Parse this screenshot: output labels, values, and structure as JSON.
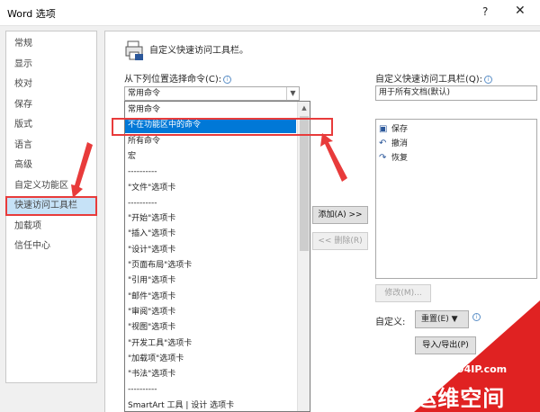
{
  "window": {
    "title": "Word 选项",
    "help": "?",
    "close": "✕"
  },
  "sidebar": {
    "items": [
      {
        "label": "常规"
      },
      {
        "label": "显示"
      },
      {
        "label": "校对"
      },
      {
        "label": "保存"
      },
      {
        "label": "版式"
      },
      {
        "label": "语言"
      },
      {
        "label": "高级"
      },
      {
        "label": "自定义功能区"
      },
      {
        "label": "快速访问工具栏",
        "selected": true
      },
      {
        "label": "加载项"
      },
      {
        "label": "信任中心"
      }
    ]
  },
  "main": {
    "title": "自定义快速访问工具栏。",
    "choose_from_label": "从下列位置选择命令(C):",
    "choose_from_value": "常用命令",
    "dropdown_items": [
      "常用命令",
      "不在功能区中的命令",
      "所有命令",
      "宏",
      "----------",
      "\"文件\"选项卡",
      "----------",
      "\"开始\"选项卡",
      "\"插入\"选项卡",
      "\"设计\"选项卡",
      "\"页面布局\"选项卡",
      "\"引用\"选项卡",
      "\"邮件\"选项卡",
      "\"审阅\"选项卡",
      "\"视图\"选项卡",
      "\"开发工具\"选项卡",
      "\"加载项\"选项卡",
      "\"书法\"选项卡",
      "----------",
      "SmartArt 工具 | 设计 选项卡"
    ],
    "selected_dropdown_item": "不在功能区中的命令",
    "add_button": "添加(A) >>",
    "remove_button": "<< 删除(R)",
    "qat_label": "自定义快速访问工具栏(Q):",
    "qat_value": "用于所有文档(默认)",
    "qat_items": [
      {
        "label": "保存",
        "icon": "save-icon"
      },
      {
        "label": "撤消",
        "icon": "undo-icon"
      },
      {
        "label": "恢复",
        "icon": "redo-icon"
      }
    ],
    "modify_button": "修改(M)...",
    "customize_label": "自定义:",
    "reset_button": "重置(E) ▼",
    "import_export_button": "导入/导出(P)"
  },
  "watermark": {
    "url": "www.94IP.com",
    "text": "IT运维空间"
  },
  "colors": {
    "accent": "#0078d7",
    "highlight": "#e83b3b",
    "sidebar_selected": "#c6e2f7"
  }
}
